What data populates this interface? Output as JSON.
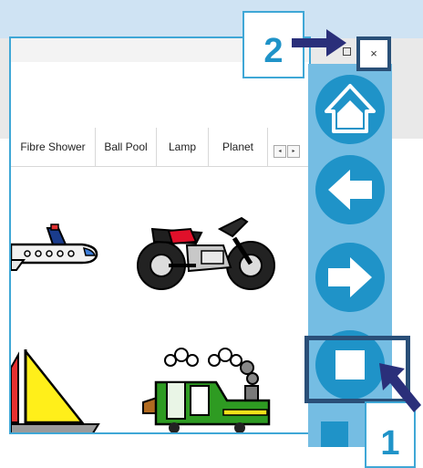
{
  "tabs": [
    {
      "label": "Fibre Shower"
    },
    {
      "label": "Ball Pool"
    },
    {
      "label": "Lamp"
    },
    {
      "label": "Planet"
    }
  ],
  "scroll": {
    "left_glyph": "◂",
    "right_glyph": "▸"
  },
  "window_controls": {
    "maximize_icon": "square-icon",
    "close_glyph": "×"
  },
  "symbols": [
    {
      "name": "aeroplane"
    },
    {
      "name": "motorbike"
    },
    {
      "name": "sailboat"
    },
    {
      "name": "train"
    }
  ],
  "sidebar": {
    "buttons": [
      {
        "name": "home",
        "icon": "home-icon"
      },
      {
        "name": "back",
        "icon": "arrow-left-icon"
      },
      {
        "name": "forward",
        "icon": "arrow-right-icon"
      },
      {
        "name": "stop",
        "icon": "stop-square-icon"
      }
    ]
  },
  "callouts": {
    "one": "1",
    "two": "2"
  },
  "colors": {
    "accent": "#1f93c8",
    "sidebar": "#75bde3",
    "highlight": "#2a4f78",
    "arrow": "#2a2f7a"
  }
}
